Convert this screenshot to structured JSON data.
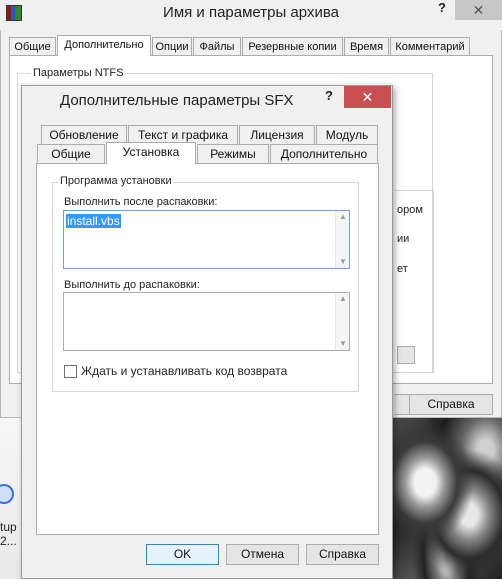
{
  "outer": {
    "title": "Имя и параметры архива",
    "help": "?",
    "close": "✕",
    "tabs": [
      "Общие",
      "Дополнительно",
      "Опции",
      "Файлы",
      "Резервные копии",
      "Время",
      "Комментарий"
    ],
    "ntfs_label": "Параметры NTFS",
    "clipped": [
      "ором",
      "ии",
      "ет"
    ],
    "help_button": "Справка"
  },
  "inner": {
    "title": "Дополнительные параметры SFX",
    "help": "?",
    "close": "✕",
    "tabs_row1": [
      "Обновление",
      "Текст и графика",
      "Лицензия",
      "Модуль"
    ],
    "tabs_row2": [
      "Общие",
      "Установка",
      "Режимы",
      "Дополнительно"
    ],
    "group_label": "Программа установки",
    "after_label": "Выполнить после распаковки:",
    "after_value": "install.vbs",
    "before_label": "Выполнить до распаковки:",
    "before_value": "",
    "wait_label": "Ждать и устанавливать код возврата",
    "wait_checked": false,
    "buttons": {
      "ok": "OK",
      "cancel": "Отмена",
      "help": "Справка"
    }
  },
  "desktop": {
    "text_line1": "tup",
    "text_line2": "2..."
  }
}
